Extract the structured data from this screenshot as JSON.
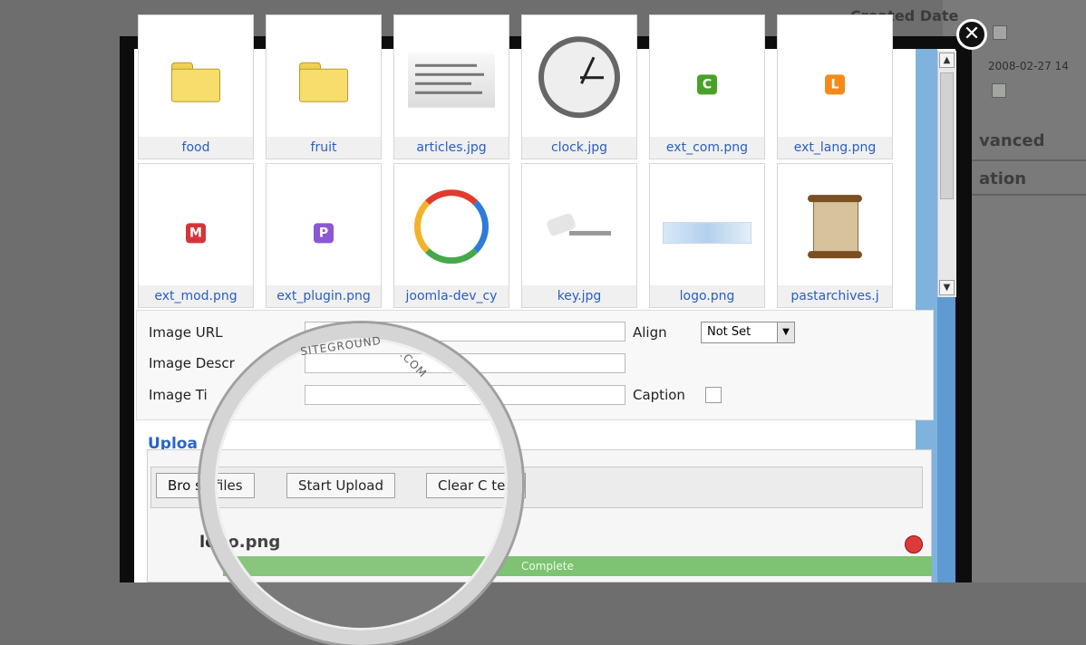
{
  "background": {
    "created_date_label": "Created Date",
    "date_value": "2008-02-27 14",
    "advanced_label": "vanced",
    "ation_label": "ation"
  },
  "thumbnails": [
    {
      "label": "food",
      "icon": "folder-icon"
    },
    {
      "label": "fruit",
      "icon": "folder-icon"
    },
    {
      "label": "articles.jpg",
      "icon": "article-image-icon"
    },
    {
      "label": "clock.jpg",
      "icon": "clock-image-icon"
    },
    {
      "label": "ext_com.png",
      "icon": "ext-com-icon",
      "letter": "C",
      "color": "#4aa12a"
    },
    {
      "label": "ext_lang.png",
      "icon": "ext-lang-icon",
      "letter": "L",
      "color": "#f28b1b"
    },
    {
      "label": "ext_mod.png",
      "icon": "ext-mod-icon",
      "letter": "M",
      "color": "#d5353a"
    },
    {
      "label": "ext_plugin.png",
      "icon": "ext-plugin-icon",
      "letter": "P",
      "color": "#8b57d3"
    },
    {
      "label": "joomla-dev_cy",
      "icon": "joomla-cycle-icon"
    },
    {
      "label": "key.jpg",
      "icon": "key-image-icon"
    },
    {
      "label": "logo.png",
      "icon": "logo-image-icon"
    },
    {
      "label": "pastarchives.j",
      "icon": "scroll-image-icon"
    }
  ],
  "fields": {
    "image_url_label": "Image URL",
    "image_description_label": "Image Descr",
    "image_title_label": "Image Ti",
    "align_label": "Align",
    "align_value": "Not Set",
    "caption_label": "Caption"
  },
  "upload": {
    "title": "Uploa d",
    "buttons": [
      "Bro se files",
      "Start Upload",
      "Clear C ted"
    ],
    "file_name": "logo.png",
    "progress_label": "Complete",
    "progress": 1
  },
  "watermark": {
    "line1": "SITEGROUND",
    "line2": ".COM"
  }
}
